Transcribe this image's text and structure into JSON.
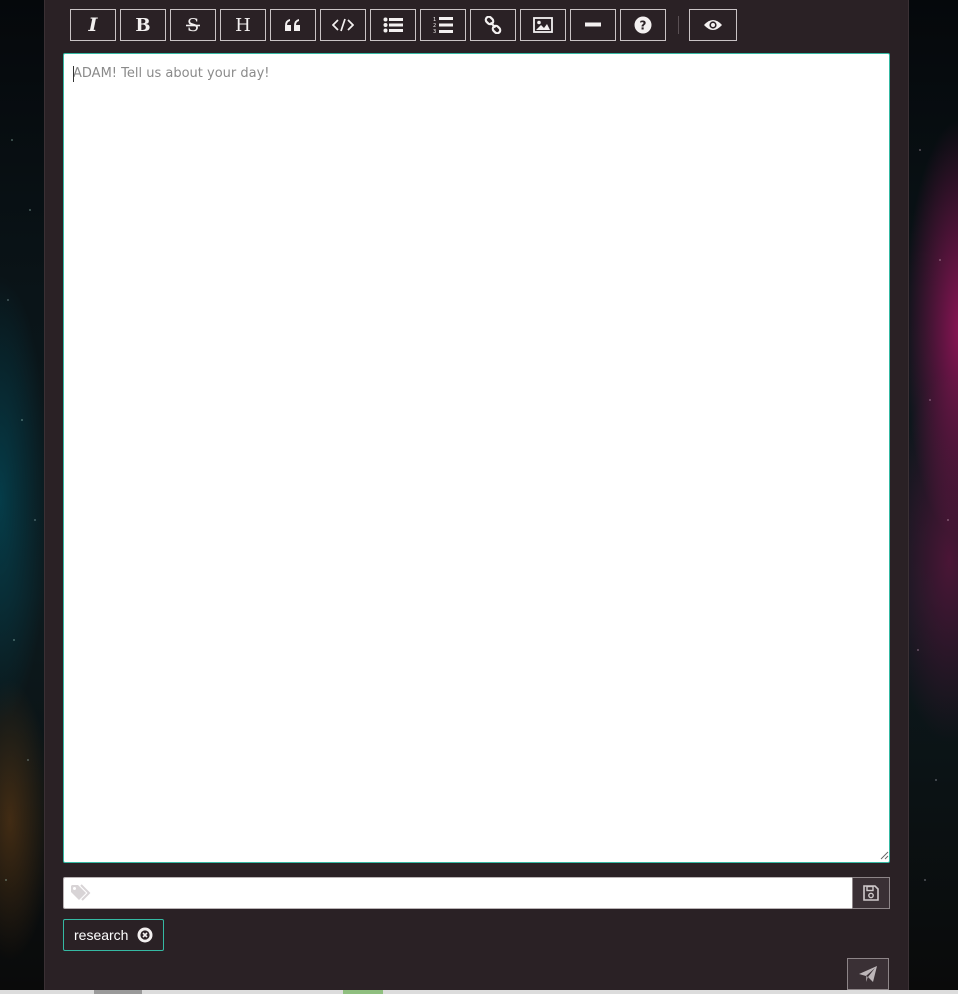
{
  "toolbar": {
    "buttons": [
      {
        "name": "italic",
        "icon": "italic-icon"
      },
      {
        "name": "bold",
        "icon": "bold-icon"
      },
      {
        "name": "strikethrough",
        "icon": "strikethrough-icon"
      },
      {
        "name": "heading",
        "icon": "heading-icon"
      },
      {
        "name": "quote",
        "icon": "quote-icon"
      },
      {
        "name": "code",
        "icon": "code-icon"
      },
      {
        "name": "unordered-list",
        "icon": "unordered-list-icon"
      },
      {
        "name": "ordered-list",
        "icon": "ordered-list-icon"
      },
      {
        "name": "link",
        "icon": "link-icon"
      },
      {
        "name": "image",
        "icon": "image-icon"
      },
      {
        "name": "horizontal-rule",
        "icon": "horizontal-rule-icon"
      },
      {
        "name": "help",
        "icon": "question-icon"
      },
      {
        "name": "preview",
        "icon": "eye-icon"
      }
    ]
  },
  "editor": {
    "value": "",
    "placeholder": "ADAM! Tell us about your day!"
  },
  "tags": {
    "input_value": "",
    "input_placeholder": "",
    "icon": "tags-icon",
    "save_icon": "floppy-disk-icon",
    "items": [
      {
        "label": "research",
        "remove_icon": "remove-circle-icon"
      }
    ]
  },
  "send": {
    "icon": "paper-plane-icon"
  },
  "colors": {
    "panel_bg": "#2a2125",
    "accent": "#35b9a3",
    "button_border": "#c9c3c5",
    "text_light": "#ffffff"
  }
}
